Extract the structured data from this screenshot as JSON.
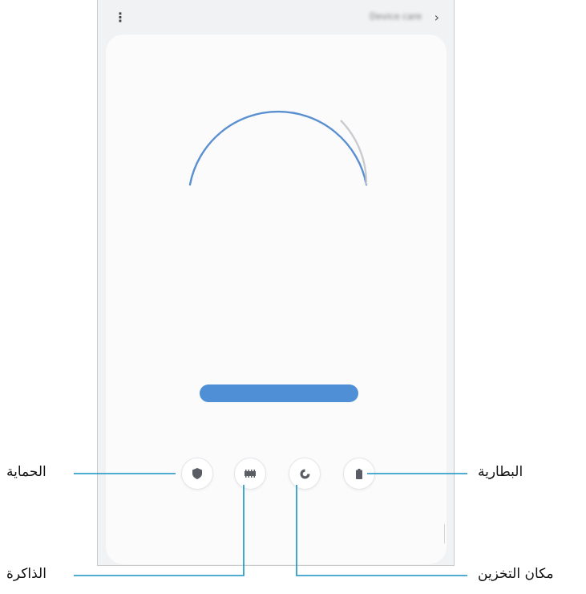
{
  "topbar": {
    "more_icon": "more-vertical-icon",
    "title": "Device care",
    "back_icon": "chevron-right-icon"
  },
  "summary": {
    "score": "",
    "score_label": ""
  },
  "description": "",
  "optimize_button": {
    "label": ""
  },
  "functions": [
    {
      "id": "security",
      "label": "",
      "sub": "",
      "icon": "shield-icon"
    },
    {
      "id": "memory",
      "label": "",
      "sub": "",
      "icon": "memory-chip-icon"
    },
    {
      "id": "storage",
      "label": "",
      "sub": "",
      "icon": "storage-pie-icon"
    },
    {
      "id": "battery",
      "label": "",
      "sub": "",
      "icon": "battery-icon"
    }
  ],
  "callouts": {
    "security": "الحماية",
    "memory": "الذاكرة",
    "storage": "مكان التخزين",
    "battery": "البطارية"
  },
  "colors": {
    "accent": "#4f8fd6",
    "callout_line": "#1591c3",
    "screen_bg": "#f1f2f4",
    "card_bg": "#fbfbfc"
  }
}
